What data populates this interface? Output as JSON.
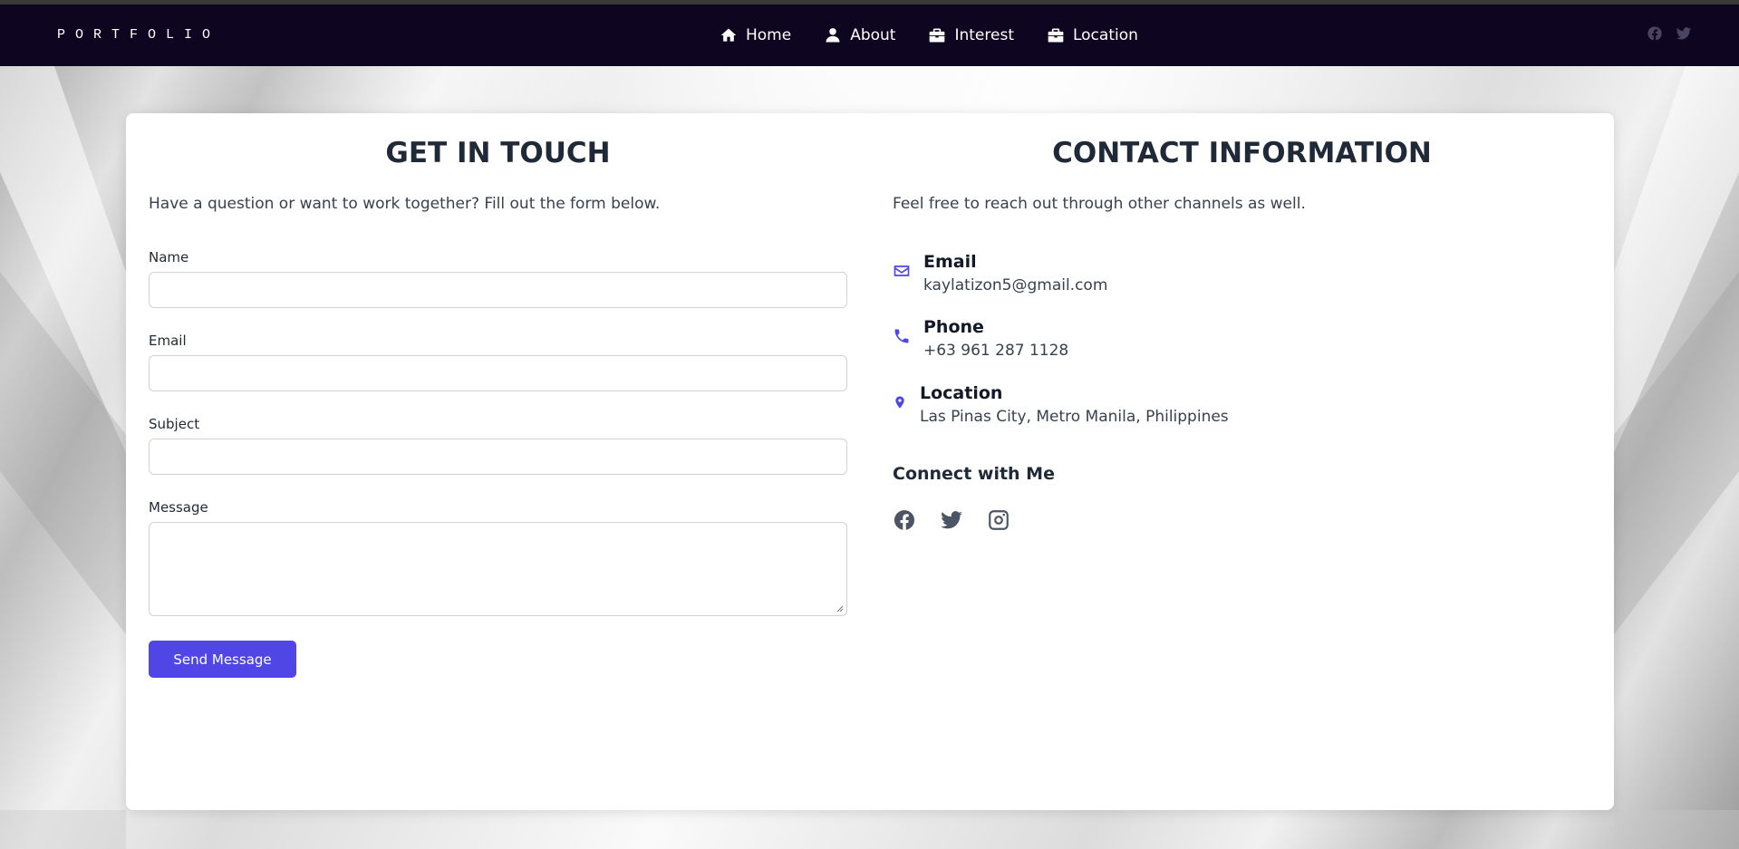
{
  "brand": "PORTFOLIO",
  "nav": {
    "items": [
      {
        "label": "Home",
        "icon": "home-icon"
      },
      {
        "label": "About",
        "icon": "user-icon"
      },
      {
        "label": "Interest",
        "icon": "briefcase-icon"
      },
      {
        "label": "Location",
        "icon": "briefcase-icon"
      }
    ],
    "social_icons": [
      "facebook-icon",
      "twitter-icon"
    ]
  },
  "form": {
    "title": "GET IN TOUCH",
    "intro": "Have a question or want to work together? Fill out the form below.",
    "fields": {
      "name_label": "Name",
      "email_label": "Email",
      "subject_label": "Subject",
      "message_label": "Message"
    },
    "submit_label": "Send Message"
  },
  "contact": {
    "title": "CONTACT INFORMATION",
    "intro": "Feel free to reach out through other channels as well.",
    "items": [
      {
        "label": "Email",
        "value": "kaylatizon5@gmail.com",
        "icon": "envelope-icon"
      },
      {
        "label": "Phone",
        "value": "+63 961 287 1128",
        "icon": "phone-icon"
      },
      {
        "label": "Location",
        "value": "Las Pinas City, Metro Manila, Philippines",
        "icon": "map-pin-icon"
      }
    ],
    "connect_title": "Connect with Me",
    "social_icons": [
      "facebook-icon",
      "twitter-icon",
      "instagram-icon"
    ]
  },
  "colors": {
    "nav_bg": "#0e0520",
    "accent": "#4f46e5",
    "heading": "#1f2937",
    "card_bg": "#ffffff"
  }
}
